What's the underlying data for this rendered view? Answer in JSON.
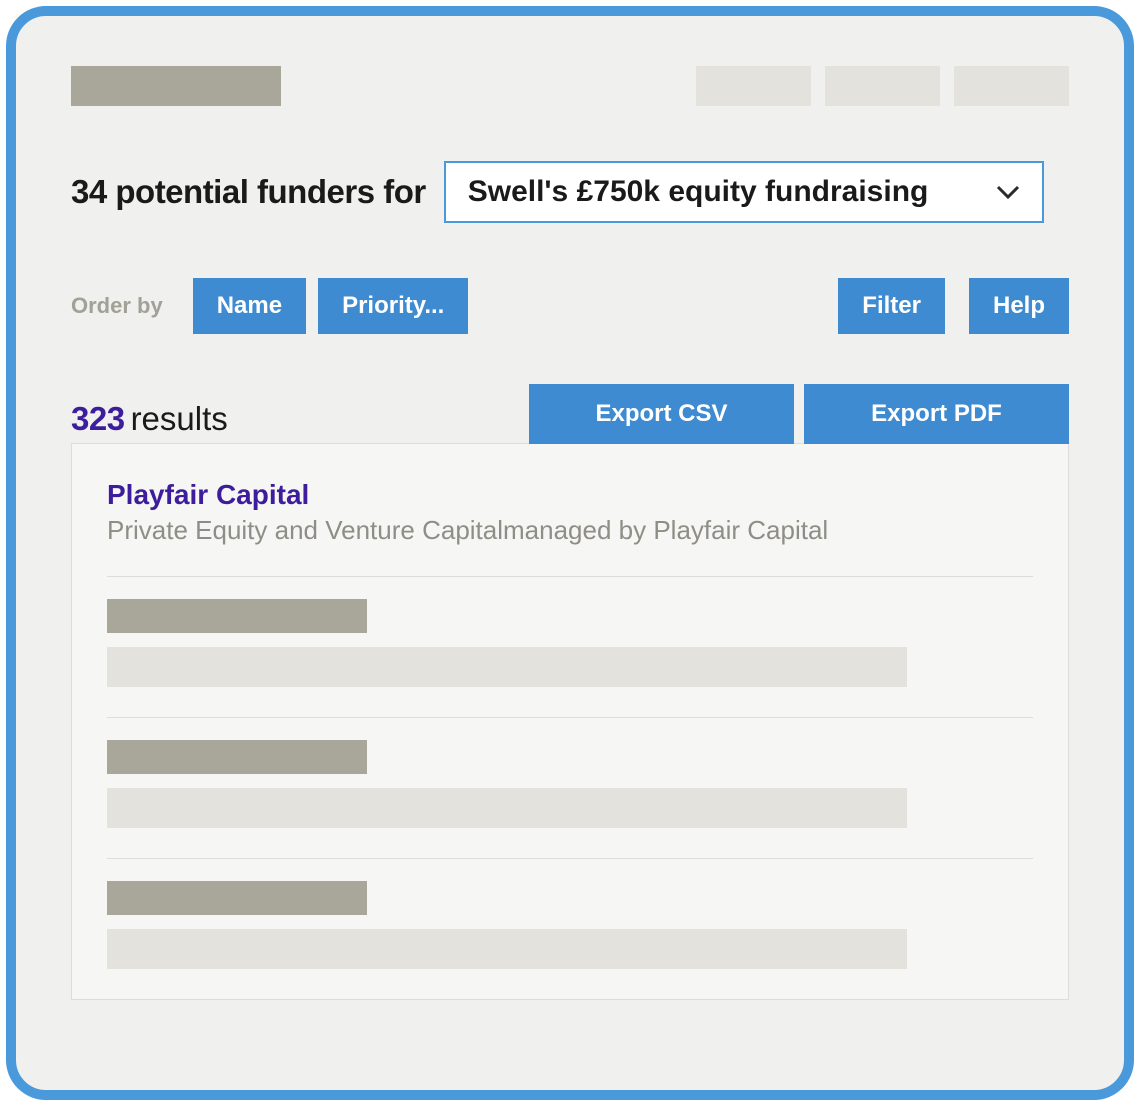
{
  "heading": {
    "prefix": "34 potential funders for",
    "selected_project": "Swell's £750k equity fundraising"
  },
  "toolbar": {
    "order_by_label": "Order by",
    "order_name": "Name",
    "order_priority": "Priority...",
    "filter": "Filter",
    "help": "Help"
  },
  "results": {
    "count": "323",
    "word": "results",
    "export_csv": "Export CSV",
    "export_pdf": "Export PDF"
  },
  "card": {
    "title": "Playfair Capital",
    "subtitle": "Private Equity and Venture Capitalmanaged by Playfair Capital"
  }
}
